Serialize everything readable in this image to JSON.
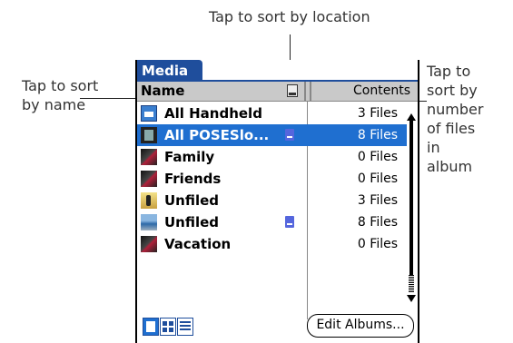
{
  "callouts": {
    "top": "Tap to sort by location",
    "left_line1": "Tap to sort",
    "left_line2": "by name",
    "right_line1": "Tap to",
    "right_line2": "sort by",
    "right_line3": "number",
    "right_line4": "of files",
    "right_line5": "in",
    "right_line6": "album"
  },
  "app": {
    "title": "Media"
  },
  "header": {
    "name_label": "Name",
    "location_icon": "card-icon",
    "contents_label": "Contents"
  },
  "rows": [
    {
      "icon": "photo-icon",
      "name": "All Handheld",
      "count": "3 Files",
      "on_card": false,
      "selected": false
    },
    {
      "icon": "film-icon",
      "name": "All POSESlo...",
      "count": "8 Files",
      "on_card": true,
      "selected": true
    },
    {
      "icon": "dark-thumb-icon",
      "name": "Family",
      "count": "0 Files",
      "on_card": false,
      "selected": false
    },
    {
      "icon": "dark-thumb-icon",
      "name": "Friends",
      "count": "0 Files",
      "on_card": false,
      "selected": false
    },
    {
      "icon": "person-thumb-icon",
      "name": "Unfiled",
      "count": "3 Files",
      "on_card": false,
      "selected": false
    },
    {
      "icon": "sea-thumb-icon",
      "name": "Unfiled",
      "count": "8 Files",
      "on_card": true,
      "selected": false
    },
    {
      "icon": "dark-thumb-icon",
      "name": "Vacation",
      "count": "0 Files",
      "on_card": false,
      "selected": false
    }
  ],
  "footer": {
    "view_buttons": [
      "single-view",
      "thumbnail-view",
      "list-view"
    ],
    "edit_albums_label": "Edit Albums..."
  },
  "colors": {
    "accent": "#1f4e9c",
    "selection": "#1f6fd0",
    "header_bg": "#c9c9c9"
  }
}
